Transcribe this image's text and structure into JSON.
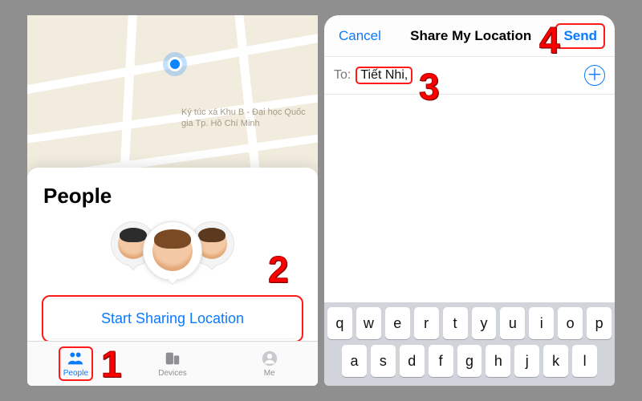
{
  "left": {
    "map_label": "Ký túc xá Khu B - Đại học Quốc gia Tp. Hồ Chí Minh",
    "sheet_title": "People",
    "share_button": "Start Sharing Location",
    "tabs": {
      "people": "People",
      "devices": "Devices",
      "me": "Me"
    }
  },
  "right": {
    "cancel": "Cancel",
    "title": "Share My Location",
    "send": "Send",
    "to_label": "To:",
    "recipient": "Tiết Nhi,",
    "add_icon_glyph": "＋"
  },
  "keyboard": {
    "row1": [
      "q",
      "w",
      "e",
      "r",
      "t",
      "y",
      "u",
      "i",
      "o",
      "p"
    ],
    "row2": [
      "a",
      "s",
      "d",
      "f",
      "g",
      "h",
      "j",
      "k",
      "l"
    ]
  },
  "annotations": {
    "n1": "1",
    "n2": "2",
    "n3": "3",
    "n4": "4"
  }
}
